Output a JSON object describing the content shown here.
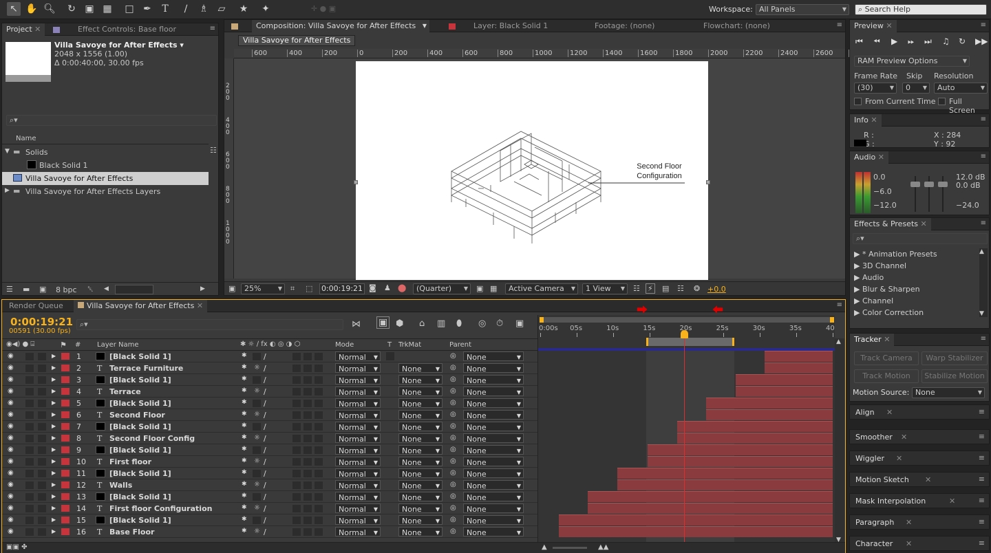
{
  "toolbar": {
    "workspace_label": "Workspace:",
    "workspace_value": "All Panels",
    "search_placeholder": "Search Help"
  },
  "project": {
    "tab_project": "Project",
    "tab_effect_controls": "Effect Controls: Base floor",
    "comp_name": "Villa Savoye for After Effects ▾",
    "comp_size": "2048 x 1556 (1.00)",
    "comp_duration": "Δ 0:00:40:00, 30.00 fps",
    "col_name": "Name",
    "items": [
      "Solids",
      "Black Solid 1",
      "Villa Savoye for After Effects",
      "Villa Savoye for After Effects Layers"
    ],
    "bpc": "8 bpc"
  },
  "composition": {
    "tab_comp": "Composition: Villa Savoye for After Effects",
    "tab_layer": "Layer: Black Solid 1",
    "tab_footage": "Footage: (none)",
    "tab_flowchart": "Flowchart: (none)",
    "breadcrumb": "Villa Savoye for After Effects",
    "ruler_ticks": [
      "600",
      "400",
      "200",
      "0",
      "200",
      "400",
      "600",
      "800",
      "1000",
      "1200",
      "1400",
      "1600",
      "1800",
      "2000",
      "2200",
      "2400",
      "2600",
      "28"
    ],
    "vruler_ticks": [
      "200",
      "400",
      "600",
      "800",
      "1000"
    ],
    "annotation_line1": "Second Floor",
    "annotation_line2": "Configuration",
    "zoom": "25%",
    "timecode": "0:00:19:21",
    "resolution": "(Quarter)",
    "camera": "Active Camera",
    "views": "1 View",
    "exposure": "+0.0"
  },
  "preview": {
    "title": "Preview",
    "ram_preview": "RAM Preview Options",
    "frame_rate_label": "Frame Rate",
    "skip_label": "Skip",
    "resolution_label": "Resolution",
    "frame_rate_value": "(30)",
    "skip_value": "0",
    "resolution_value": "Auto",
    "from_current": "From Current Time",
    "full_screen": "Full Screen"
  },
  "info": {
    "title": "Info",
    "r": "R :",
    "g": "G :",
    "x": "X : 284",
    "y": "Y : 92"
  },
  "audio": {
    "title": "Audio",
    "left_vals": [
      "0.0",
      "−6.0",
      "−12.0"
    ],
    "right_vals": [
      "12.0 dB",
      "0.0 dB",
      "−24.0"
    ]
  },
  "effects": {
    "title": "Effects & Presets",
    "items": [
      "* Animation Presets",
      "3D Channel",
      "Audio",
      "Blur & Sharpen",
      "Channel",
      "Color Correction"
    ]
  },
  "tracker": {
    "title": "Tracker",
    "track_camera": "Track Camera",
    "warp_stabilizer": "Warp Stabilizer",
    "track_motion": "Track Motion",
    "stabilize_motion": "Stabilize Motion",
    "motion_source_label": "Motion Source:",
    "motion_source_value": "None"
  },
  "side_panels": [
    "Align",
    "Smoother",
    "Wiggler",
    "Motion Sketch",
    "Mask Interpolation",
    "Paragraph",
    "Character"
  ],
  "timeline": {
    "tab_render": "Render Queue",
    "tab_comp": "Villa Savoye for After Effects",
    "timecode": "0:00:19:21",
    "frame_info": "00591 (30.00 fps)",
    "col_layer_name": "Layer Name",
    "col_mode": "Mode",
    "col_t": "T",
    "col_trkmat": "TrkMat",
    "col_parent": "Parent",
    "col_hash": "#",
    "ruler": [
      "0:00s",
      "05s",
      "10s",
      "15s",
      "20s",
      "25s",
      "30s",
      "35s",
      "40s"
    ],
    "layers": [
      {
        "num": "1",
        "name": "[Black Solid 1]",
        "type": "solid",
        "mode": "Normal",
        "trkmat": "",
        "parent": "None",
        "start": 30.7
      },
      {
        "num": "2",
        "name": "Terrace Furniture",
        "type": "text",
        "mode": "Normal",
        "trkmat": "None",
        "parent": "None",
        "start": 30.7
      },
      {
        "num": "3",
        "name": "[Black Solid 1]",
        "type": "solid",
        "mode": "Normal",
        "trkmat": "None",
        "parent": "None",
        "start": 26.7
      },
      {
        "num": "4",
        "name": "Terrace",
        "type": "text",
        "mode": "Normal",
        "trkmat": "None",
        "parent": "None",
        "start": 26.7
      },
      {
        "num": "5",
        "name": "[Black Solid 1]",
        "type": "solid",
        "mode": "Normal",
        "trkmat": "None",
        "parent": "None",
        "start": 22.7
      },
      {
        "num": "6",
        "name": "Second  Floor",
        "type": "text",
        "mode": "Normal",
        "trkmat": "None",
        "parent": "None",
        "start": 22.7
      },
      {
        "num": "7",
        "name": "[Black Solid 1]",
        "type": "solid",
        "mode": "Normal",
        "trkmat": "None",
        "parent": "None",
        "start": 18.7
      },
      {
        "num": "8",
        "name": "Second Floor Config",
        "type": "text",
        "mode": "Normal",
        "trkmat": "None",
        "parent": "None",
        "start": 18.7
      },
      {
        "num": "9",
        "name": "[Black Solid 1]",
        "type": "solid",
        "mode": "Normal",
        "trkmat": "None",
        "parent": "None",
        "start": 14.7
      },
      {
        "num": "10",
        "name": "First floor",
        "type": "text",
        "mode": "Normal",
        "trkmat": "None",
        "parent": "None",
        "start": 14.7
      },
      {
        "num": "11",
        "name": "[Black Solid 1]",
        "type": "solid",
        "mode": "Normal",
        "trkmat": "None",
        "parent": "None",
        "start": 10.5
      },
      {
        "num": "12",
        "name": "Walls",
        "type": "text",
        "mode": "Normal",
        "trkmat": "None",
        "parent": "None",
        "start": 10.5
      },
      {
        "num": "13",
        "name": "[Black Solid 1]",
        "type": "solid",
        "mode": "Normal",
        "trkmat": "None",
        "parent": "None",
        "start": 6.5
      },
      {
        "num": "14",
        "name": "First floor Configuration",
        "type": "text",
        "mode": "Normal",
        "trkmat": "None",
        "parent": "None",
        "start": 6.5
      },
      {
        "num": "15",
        "name": "[Black Solid 1]",
        "type": "solid",
        "mode": "Normal",
        "trkmat": "None",
        "parent": "None",
        "start": 2.5
      },
      {
        "num": "16",
        "name": "Base Floor",
        "type": "text",
        "mode": "Normal",
        "trkmat": "None",
        "parent": "None",
        "start": 2.5
      }
    ],
    "duration_seconds": 40,
    "current_time_seconds": 19.7,
    "work_area_seconds": [
      14.5,
      26.5
    ]
  },
  "colors": {
    "accent_orange": "#f7b21c",
    "label_red": "#c8343c",
    "layer_bar": "#8a3b3e",
    "playhead": "#d83030",
    "arrow_red": "#e00000"
  }
}
